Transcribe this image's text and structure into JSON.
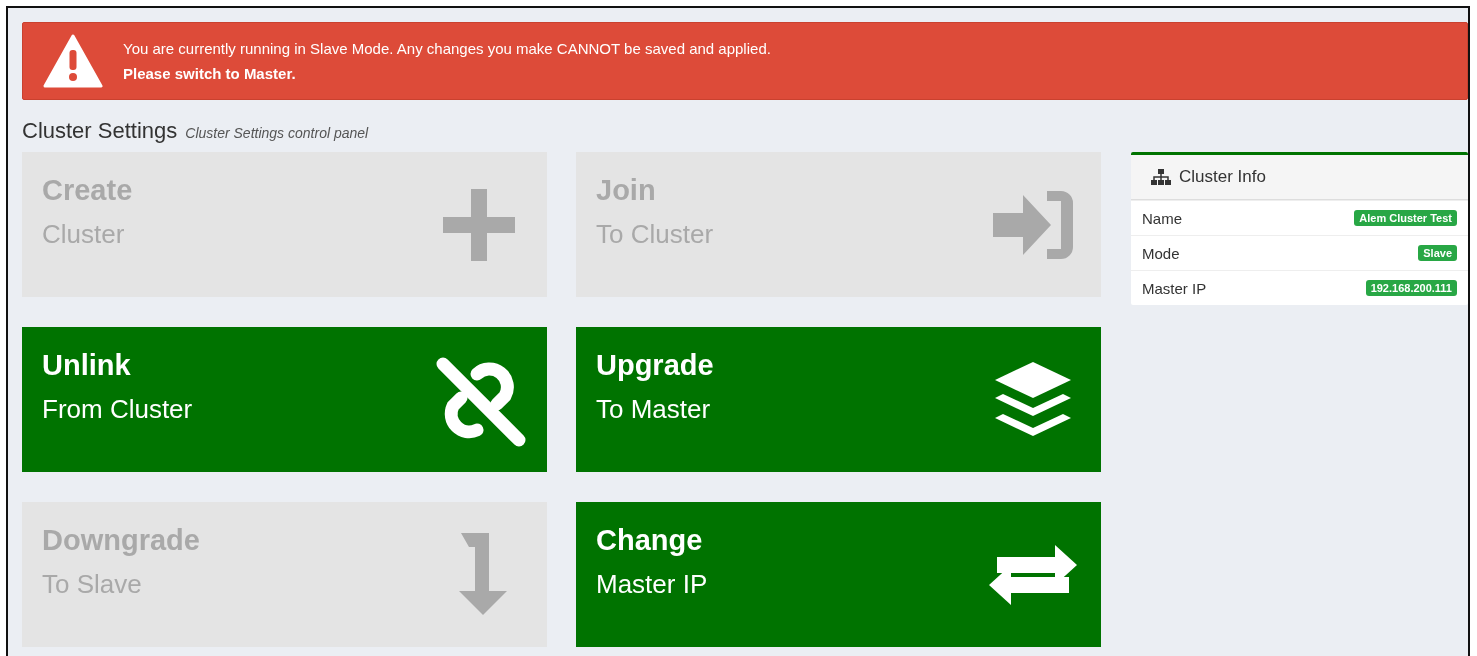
{
  "alert": {
    "message": "You are currently running in Slave Mode. Any changes you make CANNOT be saved and applied.",
    "emphasis": "Please switch to Master."
  },
  "header": {
    "title": "Cluster Settings",
    "subtitle": "Cluster Settings control panel"
  },
  "tiles": [
    {
      "title": "Create",
      "subtitle": "Cluster",
      "kind": "plus",
      "disabled": true
    },
    {
      "title": "Join",
      "subtitle": "To Cluster",
      "kind": "join",
      "disabled": true
    },
    {
      "title": "Unlink",
      "subtitle": "From Cluster",
      "kind": "unlink",
      "disabled": false
    },
    {
      "title": "Upgrade",
      "subtitle": "To Master",
      "kind": "layers",
      "disabled": false
    },
    {
      "title": "Downgrade",
      "subtitle": "To Slave",
      "kind": "down",
      "disabled": true
    },
    {
      "title": "Change",
      "subtitle": "Master IP",
      "kind": "exchange",
      "disabled": false
    }
  ],
  "cluster_info": {
    "title": "Cluster Info",
    "rows": [
      {
        "label": "Name",
        "value": "Alem Cluster Test"
      },
      {
        "label": "Mode",
        "value": "Slave"
      },
      {
        "label": "Master IP",
        "value": "192.168.200.111"
      }
    ]
  }
}
